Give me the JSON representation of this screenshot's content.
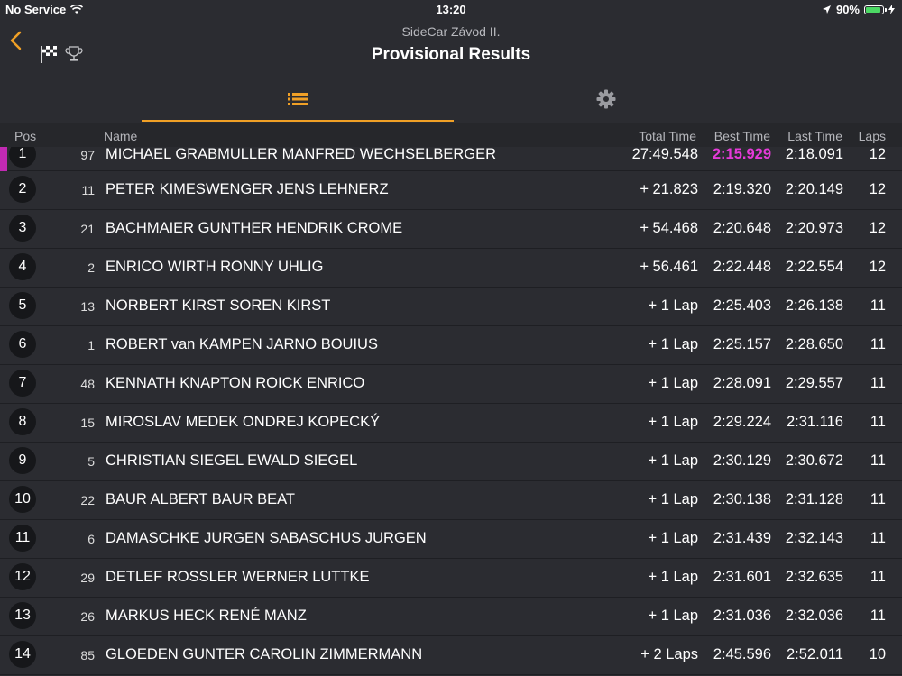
{
  "status_bar": {
    "carrier": "No Service",
    "time": "13:20",
    "battery": "90%"
  },
  "nav": {
    "subtitle": "SideCar Závod II.",
    "title": "Provisional Results",
    "icons": [
      "chevron-left-icon",
      "checkered-flag-icon",
      "trophy-icon"
    ]
  },
  "tabs": {
    "active": "list",
    "items": [
      "list-icon",
      "gear-icon"
    ],
    "accent_color": "#f0a026"
  },
  "columns": {
    "pos": "Pos",
    "name": "Name",
    "total": "Total Time",
    "best": "Best Time",
    "last": "Last Time",
    "laps": "Laps"
  },
  "fastest_color": "#e53ad8",
  "rows": [
    {
      "pos": "1",
      "num": "97",
      "name": "MICHAEL GRABMULLER MANFRED WECHSELBERGER",
      "total": "27:49.548",
      "best": "2:15.929",
      "last": "2:18.091",
      "laps": "12"
    },
    {
      "pos": "2",
      "num": "11",
      "name": "PETER KIMESWENGER JENS LEHNERZ",
      "total": "+ 21.823",
      "best": "2:19.320",
      "last": "2:20.149",
      "laps": "12"
    },
    {
      "pos": "3",
      "num": "21",
      "name": "BACHMAIER GUNTHER HENDRIK CROME",
      "total": "+ 54.468",
      "best": "2:20.648",
      "last": "2:20.973",
      "laps": "12"
    },
    {
      "pos": "4",
      "num": "2",
      "name": "ENRICO WIRTH RONNY UHLIG",
      "total": "+ 56.461",
      "best": "2:22.448",
      "last": "2:22.554",
      "laps": "12"
    },
    {
      "pos": "5",
      "num": "13",
      "name": "NORBERT KIRST SOREN KIRST",
      "total": "+ 1 Lap",
      "best": "2:25.403",
      "last": "2:26.138",
      "laps": "11"
    },
    {
      "pos": "6",
      "num": "1",
      "name": "ROBERT van KAMPEN JARNO BOUIUS",
      "total": "+ 1 Lap",
      "best": "2:25.157",
      "last": "2:28.650",
      "laps": "11"
    },
    {
      "pos": "7",
      "num": "48",
      "name": "KENNATH KNAPTON ROICK ENRICO",
      "total": "+ 1 Lap",
      "best": "2:28.091",
      "last": "2:29.557",
      "laps": "11"
    },
    {
      "pos": "8",
      "num": "15",
      "name": "MIROSLAV MEDEK ONDREJ KOPECKÝ",
      "total": "+ 1 Lap",
      "best": "2:29.224",
      "last": "2:31.116",
      "laps": "11"
    },
    {
      "pos": "9",
      "num": "5",
      "name": "CHRISTIAN SIEGEL EWALD SIEGEL",
      "total": "+ 1 Lap",
      "best": "2:30.129",
      "last": "2:30.672",
      "laps": "11"
    },
    {
      "pos": "10",
      "num": "22",
      "name": "BAUR ALBERT BAUR BEAT",
      "total": "+ 1 Lap",
      "best": "2:30.138",
      "last": "2:31.128",
      "laps": "11"
    },
    {
      "pos": "11",
      "num": "6",
      "name": "DAMASCHKE JURGEN SABASCHUS JURGEN",
      "total": "+ 1 Lap",
      "best": "2:31.439",
      "last": "2:32.143",
      "laps": "11"
    },
    {
      "pos": "12",
      "num": "29",
      "name": "DETLEF ROSSLER WERNER LUTTKE",
      "total": "+ 1 Lap",
      "best": "2:31.601",
      "last": "2:32.635",
      "laps": "11"
    },
    {
      "pos": "13",
      "num": "26",
      "name": "MARKUS HECK RENÉ MANZ",
      "total": "+ 1 Lap",
      "best": "2:31.036",
      "last": "2:32.036",
      "laps": "11"
    },
    {
      "pos": "14",
      "num": "85",
      "name": "GLOEDEN GUNTER CAROLIN ZIMMERMANN",
      "total": "+ 2 Laps",
      "best": "2:45.596",
      "last": "2:52.011",
      "laps": "10"
    }
  ]
}
